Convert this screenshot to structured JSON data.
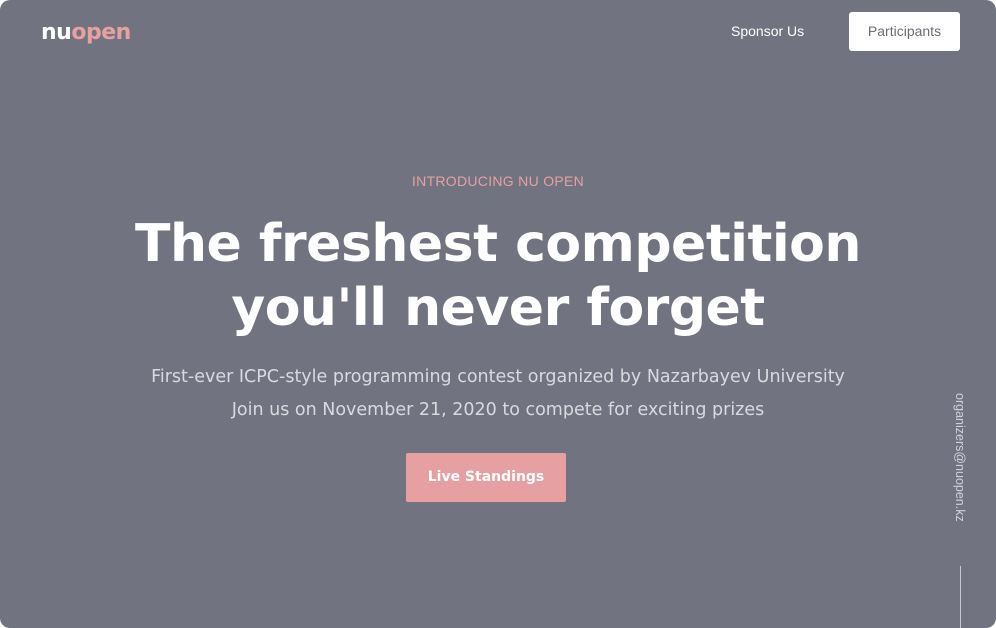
{
  "brand": {
    "logo_part1": "nu",
    "logo_part2": "open",
    "accent_color": "#e6a0a2",
    "background_color": "#717480"
  },
  "nav": {
    "sponsor_label": "Sponsor Us",
    "participants_label": "Participants"
  },
  "hero": {
    "eyebrow": "INTRODUCING NU OPEN",
    "headline_line1": "The freshest competition",
    "headline_line2": "you'll never forget",
    "subtext_line1": "First-ever ICPC-style programming contest organized by Nazarbayev University",
    "subtext_line2": "Join us on November 21, 2020 to compete for exciting prizes",
    "cta_label": "Live Standings"
  },
  "side": {
    "email": "organizers@nuopen.kz"
  }
}
